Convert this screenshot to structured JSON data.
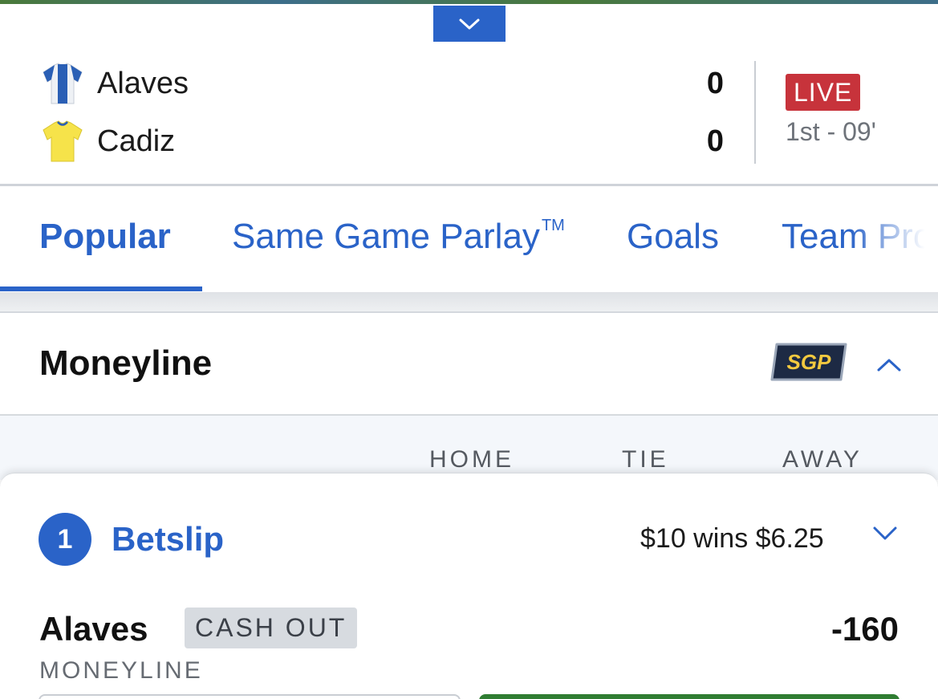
{
  "match": {
    "home": {
      "name": "Alaves",
      "score": "0",
      "jersey_icon": "jersey-blue-white-icon"
    },
    "away": {
      "name": "Cadiz",
      "score": "0",
      "jersey_icon": "jersey-yellow-icon"
    },
    "status": "LIVE",
    "clock": "1st - 09'"
  },
  "tabs": [
    {
      "label": "Popular",
      "active": true
    },
    {
      "label": "Same Game Parlay",
      "sup": "TM",
      "active": false
    },
    {
      "label": "Goals",
      "active": false
    },
    {
      "label": "Team Pro",
      "active": false
    }
  ],
  "market": {
    "title": "Moneyline",
    "badge": "SGP",
    "columns": [
      "HOME",
      "TIE",
      "AWAY"
    ]
  },
  "betslip": {
    "count": "1",
    "title": "Betslip",
    "summary": "$10 wins $6.25",
    "selection": {
      "name": "Alaves",
      "cashout_label": "CASH OUT",
      "odds": "-160",
      "market": "MONEYLINE"
    }
  },
  "colors": {
    "brand_blue": "#2a63c8",
    "live_red": "#c7333b",
    "sgp_navy": "#1d2a44",
    "sgp_yellow": "#f3c93f",
    "place_green": "#2f7d32"
  }
}
